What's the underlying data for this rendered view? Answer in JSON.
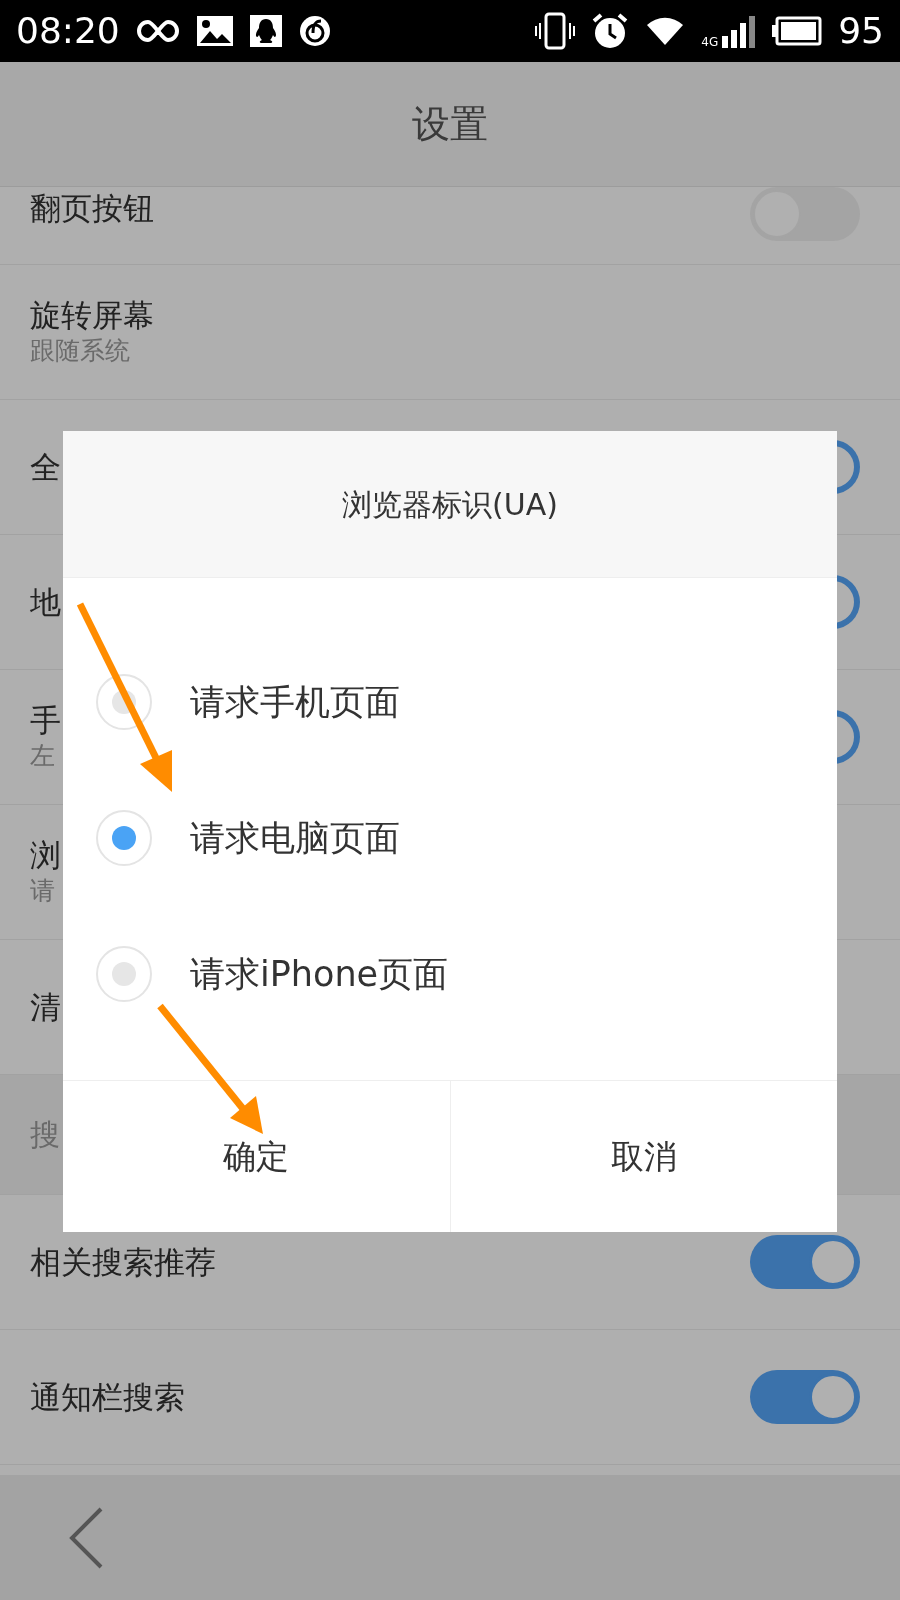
{
  "status_bar": {
    "time": "08:20",
    "network": "4G",
    "battery": "95"
  },
  "header": {
    "title": "设置"
  },
  "settings": [
    {
      "kind": "toggle",
      "title": "翻页按钮",
      "on": false
    },
    {
      "kind": "value",
      "title": "旋转屏幕",
      "subtitle": "跟随系统"
    },
    {
      "kind": "toggle",
      "title": "全",
      "on": true
    },
    {
      "kind": "toggle",
      "title": "地",
      "on": true
    },
    {
      "kind": "toggle",
      "title": "手",
      "subtitle": "左",
      "on": true
    },
    {
      "kind": "value",
      "title": "浏",
      "subtitle": "请"
    },
    {
      "kind": "value",
      "title": "清"
    },
    {
      "kind": "section",
      "title": "搜"
    },
    {
      "kind": "toggle",
      "title": "相关搜索推荐",
      "on": true
    },
    {
      "kind": "toggle",
      "title": "通知栏搜索",
      "on": true
    }
  ],
  "dialog": {
    "title": "浏览器标识(UA)",
    "options": [
      {
        "label": "请求手机页面",
        "selected": false
      },
      {
        "label": "请求电脑页面",
        "selected": true
      },
      {
        "label": "请求iPhone页面",
        "selected": false
      }
    ],
    "buttons": [
      "确定",
      "取消"
    ]
  }
}
